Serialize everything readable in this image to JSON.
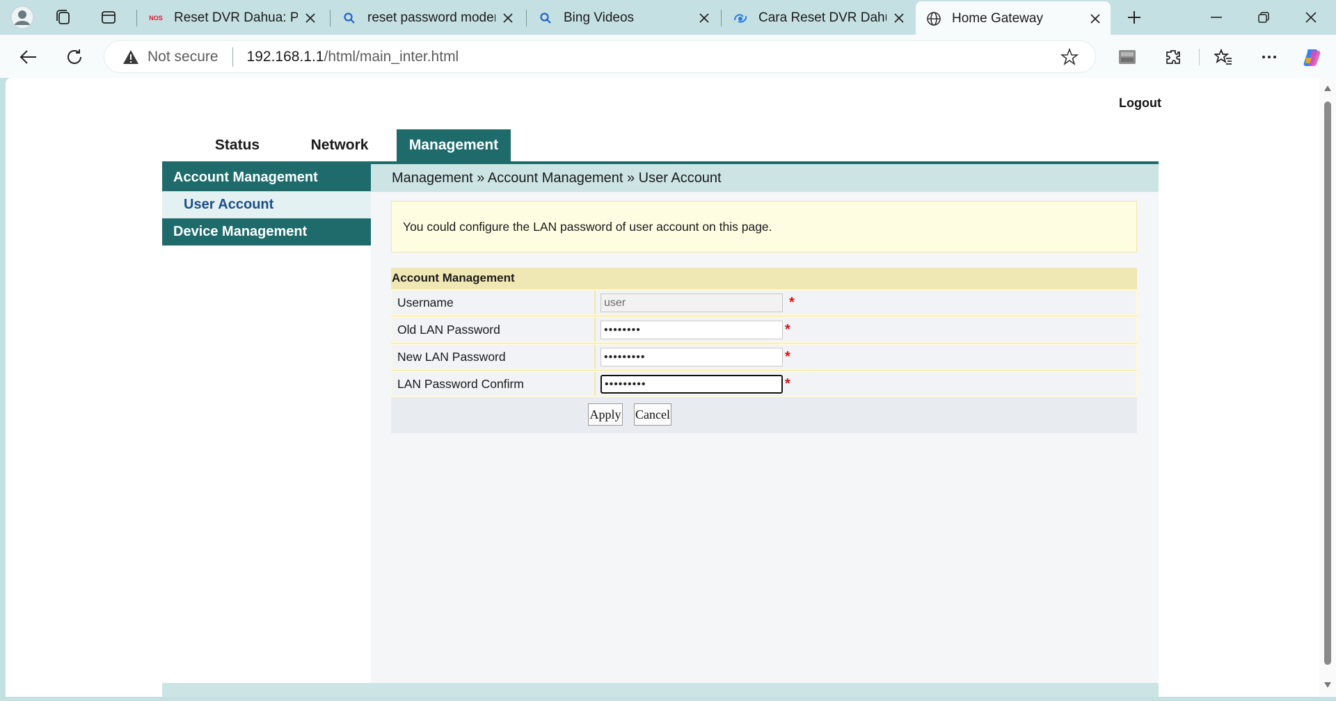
{
  "browser": {
    "tabs": [
      {
        "title": "Reset DVR Dahua: Pand",
        "favicon": "nos-logo"
      },
      {
        "title": "reset password modem",
        "favicon": "search-icon"
      },
      {
        "title": "Bing Videos",
        "favicon": "search-icon"
      },
      {
        "title": "Cara Reset DVR Dahua",
        "favicon": "cloud-swirl-icon"
      },
      {
        "title": "Home Gateway",
        "favicon": "globe-icon",
        "active": true
      }
    ],
    "address": {
      "security_label": "Not secure",
      "host": "192.168.1.1",
      "path": "/html/main_inter.html"
    }
  },
  "page": {
    "logout_label": "Logout",
    "nav_tabs": [
      "Status",
      "Network",
      "Management"
    ],
    "active_tab": "Management",
    "sidebar": {
      "section1": "Account Management",
      "section1_item": "User Account",
      "section2": "Device Management"
    },
    "breadcrumb": "Management » Account Management » User Account",
    "notice": "You could configure the LAN password of user account on this page.",
    "form": {
      "title": "Account Management",
      "username_label": "Username",
      "username_value": "user",
      "old_password_label": "Old LAN Password",
      "old_password_value": "••••••••",
      "new_password_label": "New LAN Password",
      "new_password_value": "•••••••••",
      "confirm_label": "LAN Password Confirm",
      "confirm_value": "•••••••••",
      "required_mark": "*",
      "apply_label": "Apply",
      "cancel_label": "Cancel"
    }
  },
  "colors": {
    "accent": "#1f6b6c",
    "required": "#e01010",
    "notice_bg": "#fffde1"
  }
}
